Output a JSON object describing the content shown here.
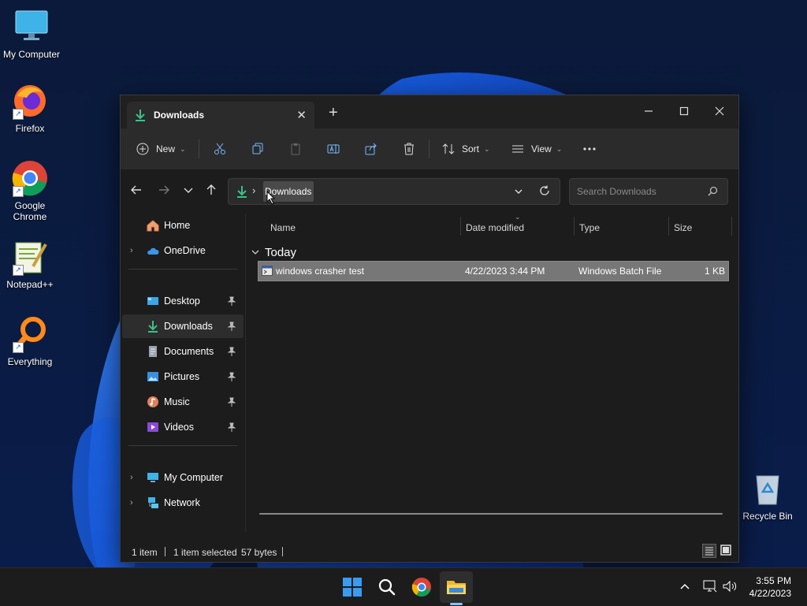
{
  "desktop": {
    "icons": [
      {
        "label": "My Computer"
      },
      {
        "label": "Firefox"
      },
      {
        "label": "Google Chrome"
      },
      {
        "label": "Notepad++"
      },
      {
        "label": "Everything"
      },
      {
        "label": "Recycle Bin"
      }
    ]
  },
  "window": {
    "tab_title": "Downloads",
    "toolbar": {
      "new_label": "New",
      "sort_label": "Sort",
      "view_label": "View"
    },
    "address": {
      "crumb": "Downloads"
    },
    "search": {
      "placeholder": "Search Downloads"
    },
    "sidebar": {
      "items": [
        {
          "label": "Home"
        },
        {
          "label": "OneDrive"
        },
        {
          "label": "Desktop"
        },
        {
          "label": "Downloads"
        },
        {
          "label": "Documents"
        },
        {
          "label": "Pictures"
        },
        {
          "label": "Music"
        },
        {
          "label": "Videos"
        },
        {
          "label": "My Computer"
        },
        {
          "label": "Network"
        }
      ]
    },
    "columns": [
      "Name",
      "Date modified",
      "Type",
      "Size"
    ],
    "group_label": "Today",
    "files": [
      {
        "name": "windows crasher test",
        "date": "4/22/2023 3:44 PM",
        "type": "Windows Batch File",
        "size": "1 KB"
      }
    ],
    "status": {
      "count": "1 item",
      "selected": "1 item selected",
      "bytes": "57 bytes"
    }
  },
  "taskbar": {
    "time": "3:55 PM",
    "date": "4/22/2023"
  }
}
